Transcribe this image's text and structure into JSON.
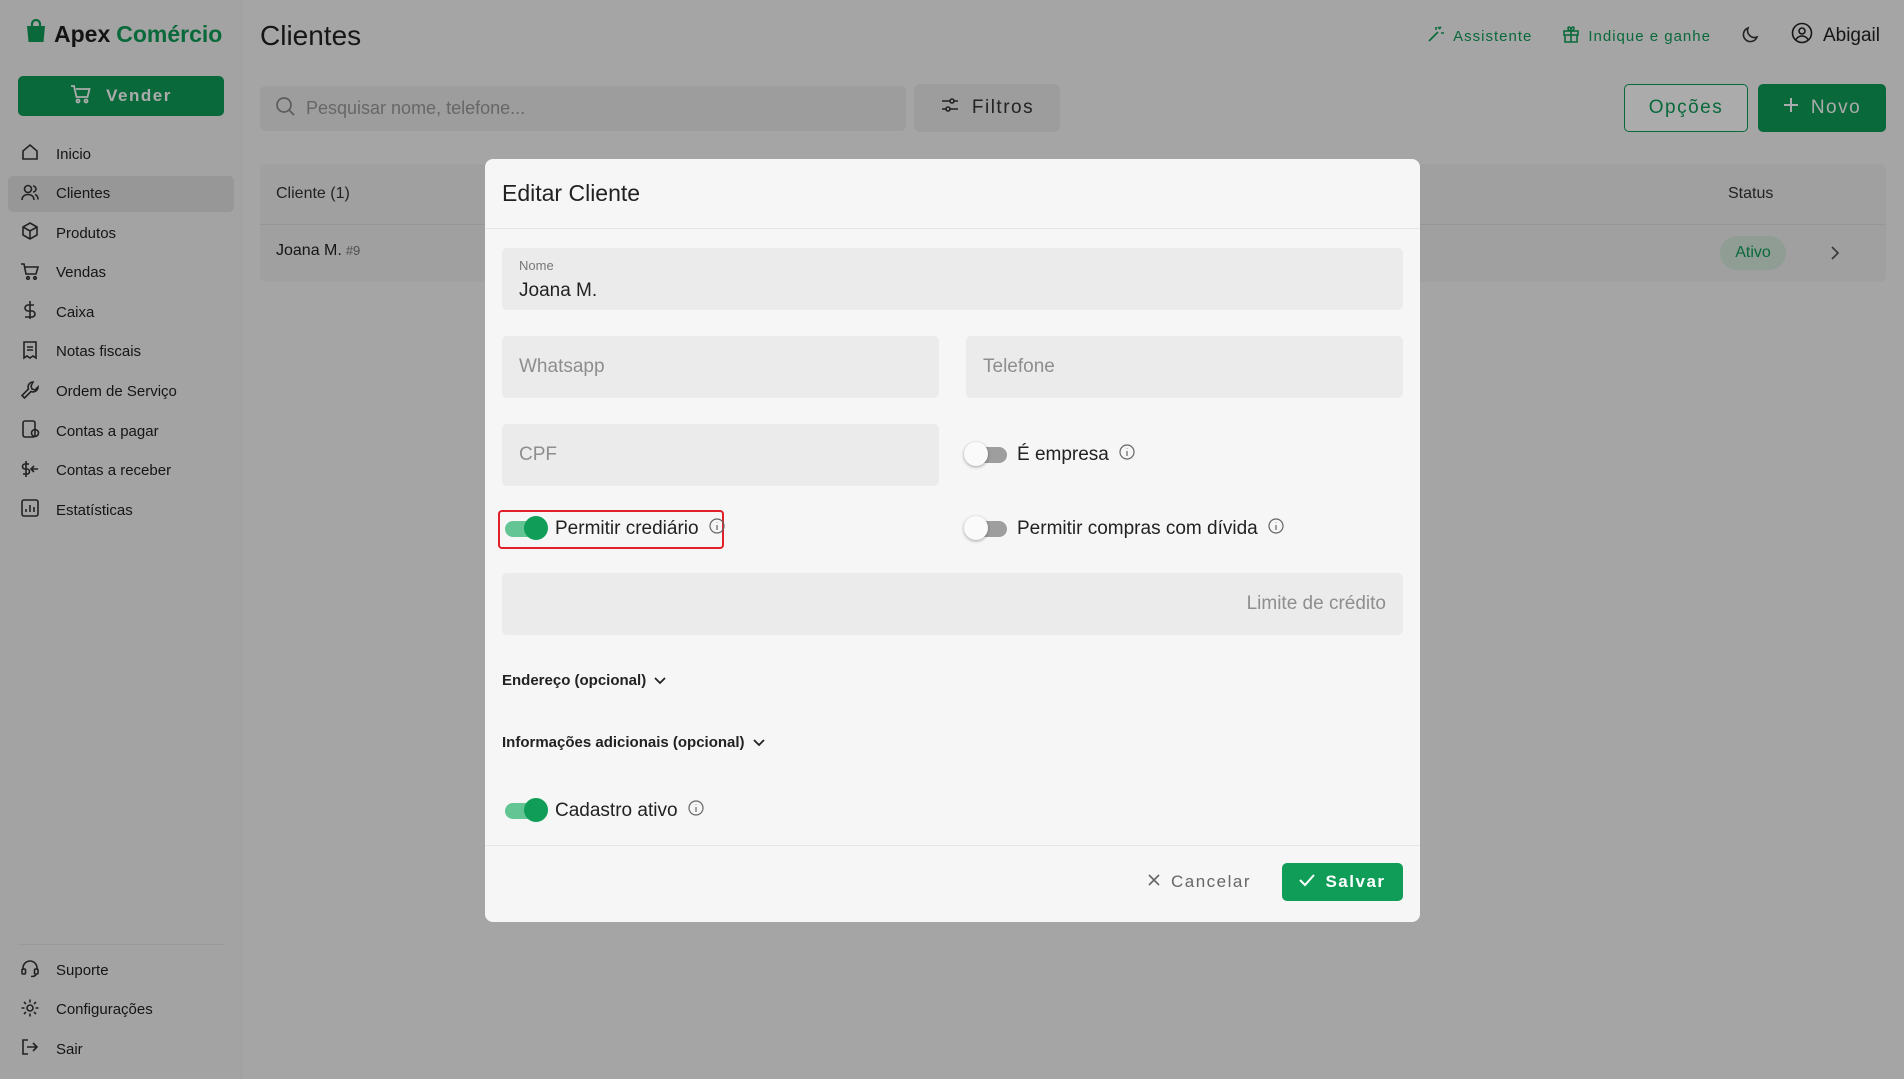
{
  "app": {
    "brand_part1": "Apex",
    "brand_part2": "Comércio",
    "brand_color": "#0f9d58"
  },
  "sidebar": {
    "sell_label": "Vender",
    "items": [
      {
        "label": "Inicio",
        "icon": "home-icon"
      },
      {
        "label": "Clientes",
        "icon": "users-icon",
        "active": true
      },
      {
        "label": "Produtos",
        "icon": "box-icon"
      },
      {
        "label": "Vendas",
        "icon": "cart-icon"
      },
      {
        "label": "Caixa",
        "icon": "dollar-icon"
      },
      {
        "label": "Notas fiscais",
        "icon": "receipt-icon"
      },
      {
        "label": "Ordem de Serviço",
        "icon": "wrench-icon"
      },
      {
        "label": "Contas a pagar",
        "icon": "bill-icon"
      },
      {
        "label": "Contas a receber",
        "icon": "receive-money-icon"
      },
      {
        "label": "Estatísticas",
        "icon": "chart-icon"
      }
    ],
    "bottom_items": [
      {
        "label": "Suporte",
        "icon": "headset-icon"
      },
      {
        "label": "Configurações",
        "icon": "gear-icon"
      },
      {
        "label": "Sair",
        "icon": "logout-icon"
      }
    ]
  },
  "header": {
    "title": "Clientes",
    "assistant_label": "Assistente",
    "referral_label": "Indique e ganhe",
    "user_name": "Abigail"
  },
  "toolbar": {
    "search_placeholder": "Pesquisar nome, telefone...",
    "filters_label": "Filtros",
    "options_label": "Opções",
    "new_label": "Novo"
  },
  "table": {
    "col_client": "Cliente (1)",
    "col_status": "Status",
    "rows": [
      {
        "name": "Joana M.",
        "id": "#9",
        "status": "Ativo"
      }
    ]
  },
  "modal": {
    "title": "Editar Cliente",
    "name_label": "Nome",
    "name_value": "Joana M.",
    "whatsapp_placeholder": "Whatsapp",
    "phone_placeholder": "Telefone",
    "cpf_placeholder": "CPF",
    "is_company_label": "É empresa",
    "is_company_on": false,
    "allow_credit_label": "Permitir crediário",
    "allow_credit_on": true,
    "allow_debt_label": "Permitir compras com dívida",
    "allow_debt_on": false,
    "credit_limit_placeholder": "Limite de crédito",
    "address_section": "Endereço (opcional)",
    "additional_section": "Informações adicionais (opcional)",
    "active_label": "Cadastro ativo",
    "active_on": true,
    "cancel_label": "Cancelar",
    "save_label": "Salvar"
  }
}
